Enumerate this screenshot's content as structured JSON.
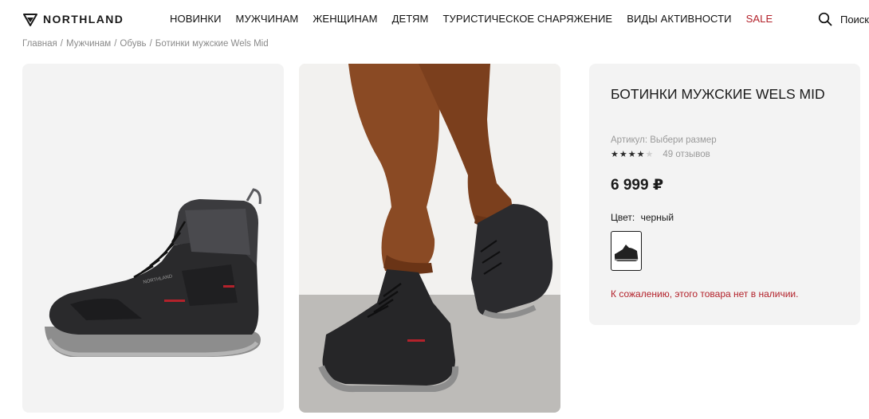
{
  "header": {
    "logo_text": "NORTHLAND",
    "nav": [
      "НОВИНКИ",
      "МУЖЧИНАМ",
      "ЖЕНЩИНАМ",
      "ДЕТЯМ",
      "ТУРИСТИЧЕСКОЕ СНАРЯЖЕНИЕ",
      "ВИДЫ АКТИВНОСТИ",
      "SALE"
    ],
    "search_label": "Поиск"
  },
  "breadcrumb": [
    "Главная",
    "Мужчинам",
    "Обувь",
    "Ботинки мужские Wels Mid"
  ],
  "product": {
    "title": "Ботинки мужские Wels Mid",
    "article": "Артикул: Выбери размер",
    "rating": 4,
    "rating_max": 5,
    "reviews": "49 отзывов",
    "price": "6 999 ₽",
    "color_label": "Цвет:",
    "color_value": "черный",
    "availability": "К сожалению, этого товара нет в наличии."
  },
  "colors": {
    "accent_red": "#b3222b",
    "card_bg": "#f3f3f3"
  }
}
